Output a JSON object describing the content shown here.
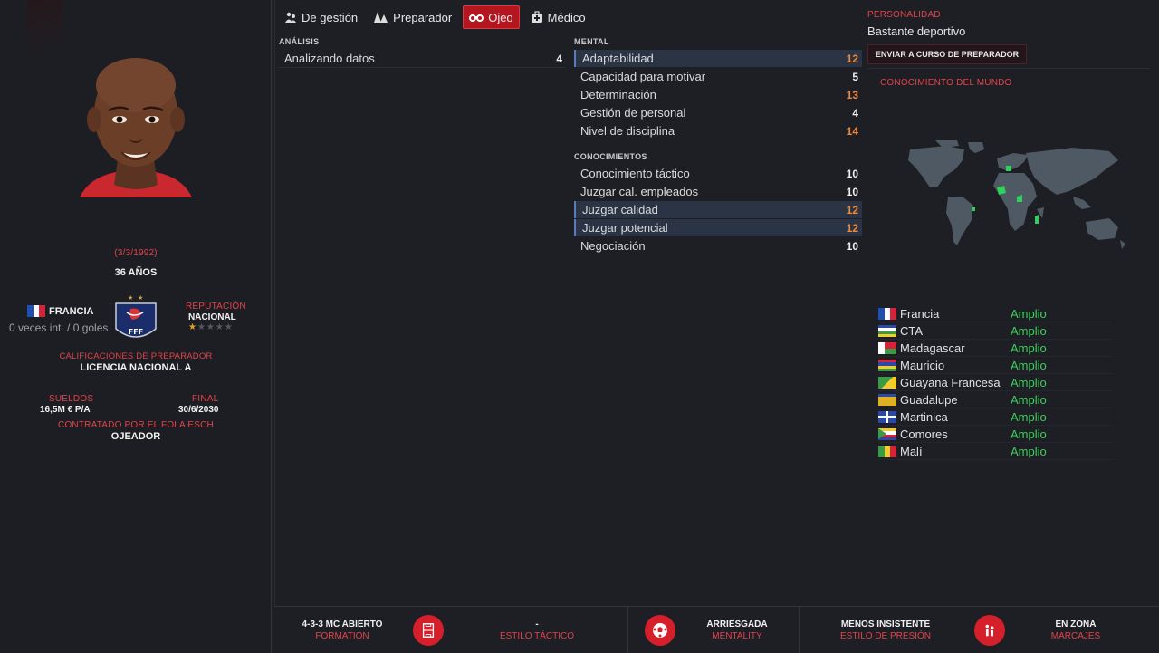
{
  "profile": {
    "dob": "(3/3/1992)",
    "age": "36 AÑOS",
    "nation": "FRANCIA",
    "caps": "0 veces int. / 0 goles",
    "reputation_label": "REPUTACIÓN",
    "reputation_value": "NACIONAL",
    "reputation_stars": 1,
    "qual_label": "CALIFICACIONES DE PREPARADOR",
    "qual_value": "LICENCIA NACIONAL A",
    "wage_label": "SUELDOS",
    "wage_value": "16,5M € P/A",
    "end_label": "FINAL",
    "end_value": "30/6/2030",
    "contract_label": "CONTRATADO POR EL FOLA ESCH",
    "role": "OJEADOR",
    "badge_text": "FFF"
  },
  "tabs": [
    {
      "label": "De gestión",
      "icon": "people-icon",
      "active": false
    },
    {
      "label": "Preparador",
      "icon": "cones-icon",
      "active": false
    },
    {
      "label": "Ojeo",
      "icon": "binoculars-icon",
      "active": true
    },
    {
      "label": "Médico",
      "icon": "medical-kit-icon",
      "active": false
    }
  ],
  "analysis": {
    "header": "ANÁLISIS",
    "rows": [
      {
        "label": "Analizando datos",
        "value": "4"
      }
    ]
  },
  "mental": {
    "header": "MENTAL",
    "rows": [
      {
        "label": "Adaptabilidad",
        "value": "12"
      },
      {
        "label": "Capacidad para motivar",
        "value": "5"
      },
      {
        "label": "Determinación",
        "value": "13"
      },
      {
        "label": "Gestión de personal",
        "value": "4"
      },
      {
        "label": "Nivel de disciplina",
        "value": "14"
      }
    ]
  },
  "knowledge": {
    "header": "CONOCIMIENTOS",
    "rows": [
      {
        "label": "Conocimiento táctico",
        "value": "10"
      },
      {
        "label": "Juzgar cal. empleados",
        "value": "10"
      },
      {
        "label": "Juzgar calidad",
        "value": "12"
      },
      {
        "label": "Juzgar potencial",
        "value": "12"
      },
      {
        "label": "Negociación",
        "value": "10"
      }
    ]
  },
  "personality": {
    "label": "PERSONALIDAD",
    "value": "Bastante deportivo",
    "send_button": "ENVIAR A CURSO DE PREPARADOR",
    "world_label": "CONOCIMIENTO DEL MUNDO"
  },
  "countries": [
    {
      "name": "Francia",
      "level": "Amplio"
    },
    {
      "name": "CTA",
      "level": "Amplio"
    },
    {
      "name": "Madagascar",
      "level": "Amplio"
    },
    {
      "name": "Mauricio",
      "level": "Amplio"
    },
    {
      "name": "Guayana Francesa",
      "level": "Amplio"
    },
    {
      "name": "Guadalupe",
      "level": "Amplio"
    },
    {
      "name": "Martinica",
      "level": "Amplio"
    },
    {
      "name": "Comores",
      "level": "Amplio"
    },
    {
      "name": "Malí",
      "level": "Amplio"
    }
  ],
  "bottom": {
    "formation_value": "4-3-3 MC ABIERTO",
    "formation_label": "FORMATION",
    "style_value": "-",
    "style_label": "ESTILO TÁCTICO",
    "mentality_value": "ARRIESGADA",
    "mentality_label": "MENTALITY",
    "press_value": "MENOS INSISTENTE",
    "press_label": "ESTILO DE PRESIÓN",
    "marking_value": "EN ZONA",
    "marking_label": "MARCAJES"
  },
  "colors": {
    "accent": "#b4161f",
    "label_red": "#e0434b",
    "good_green": "#3ccf5e",
    "highlight_orange": "#f08a3c"
  }
}
